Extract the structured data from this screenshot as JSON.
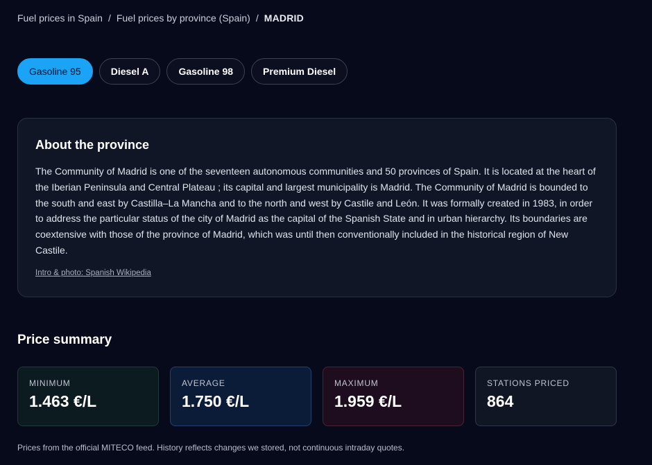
{
  "breadcrumb": {
    "items": [
      {
        "label": "Fuel prices in Spain"
      },
      {
        "label": "Fuel prices by province (Spain)"
      }
    ],
    "separator": "/",
    "current": "MADRID"
  },
  "tabs": [
    {
      "label": "Gasoline 95",
      "active": true
    },
    {
      "label": "Diesel A",
      "active": false
    },
    {
      "label": "Gasoline 98",
      "active": false
    },
    {
      "label": "Premium Diesel",
      "active": false
    }
  ],
  "about": {
    "title": "About the province",
    "text": "The Community of Madrid is one of the seventeen autonomous communities and 50 provinces of Spain. It is located at the heart of the Iberian Peninsula and Central Plateau ; its capital and largest municipality is Madrid. The Community of Madrid is bounded to the south and east by Castilla–La Mancha and to the north and west by Castile and León. It was formally created in 1983, in order to address the particular status of the city of Madrid as the capital of the Spanish State and in urban hierarchy. Its boundaries are coextensive with those of the province of Madrid, which was until then conventionally included in the historical region of New Castile.",
    "credit": "Intro & photo: Spanish Wikipedia"
  },
  "summary": {
    "title": "Price summary",
    "stats": [
      {
        "label": "MINIMUM",
        "value": "1.463 €/L"
      },
      {
        "label": "AVERAGE",
        "value": "1.750 €/L"
      },
      {
        "label": "MAXIMUM",
        "value": "1.959 €/L"
      },
      {
        "label": "STATIONS PRICED",
        "value": "864"
      }
    ]
  },
  "footnote": "Prices from the official MITECO feed. History reflects changes we stored, not continuous intraday quotes.",
  "colors": {
    "background": "#070a1a",
    "accent": "#1ba4f5"
  }
}
